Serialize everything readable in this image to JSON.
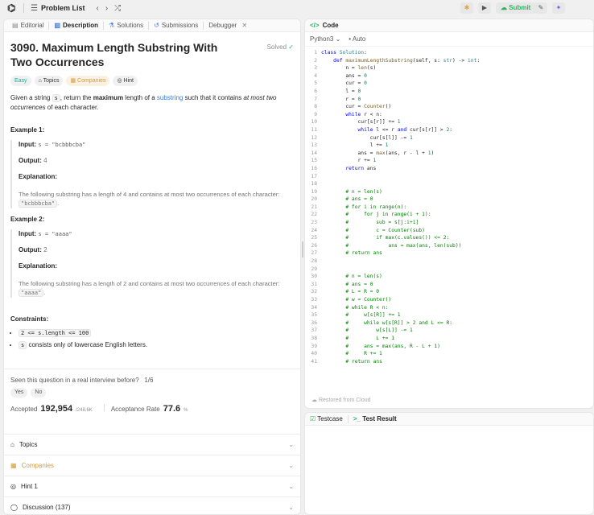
{
  "topbar": {
    "title": "Problem List",
    "submit_label": "Submit"
  },
  "left": {
    "tabs": [
      "Editorial",
      "Description",
      "Solutions",
      "Submissions",
      "Debugger"
    ],
    "title": "3090. Maximum Length Substring With Two Occurrences",
    "solved": "Solved",
    "chips": [
      "Easy",
      "Topics",
      "Companies",
      "Hint"
    ],
    "desc": {
      "p1": "Given a string ",
      "s": "s",
      "p2": ", return the ",
      "max": "maximum",
      "p3": " length of a ",
      "substring": "substring",
      "p4": " such that it contains ",
      "em": "at most two occurrences",
      "p5": " of each character."
    },
    "ex1": {
      "heading": "Example 1:",
      "input_label": "Input:",
      "input": "s = \"bcbbbcba\"",
      "output_label": "Output:",
      "output": "4",
      "expl_label": "Explanation:",
      "expl": "The following substring has a length of 4 and contains at most two occurrences of each character:",
      "sub": "\"bcbbbcba\"",
      "dot": "."
    },
    "ex2": {
      "heading": "Example 2:",
      "input_label": "Input:",
      "input": "s = \"aaaa\"",
      "output_label": "Output:",
      "output": "2",
      "expl_label": "Explanation:",
      "expl": "The following substring has a length of 2 and contains at most two occurrences of each character:",
      "sub": "\"aaaa\"",
      "dot": "."
    },
    "constraints": {
      "heading": "Constraints:",
      "c1": "2 <= s.length <= 100",
      "c2_code": "s",
      "c2_text": " consists only of lowercase English letters."
    },
    "seen": "Seen this question in a real interview before?",
    "seen_count": "1/6",
    "yes": "Yes",
    "no": "No",
    "accepted_label": "Accepted",
    "accepted": "192,954",
    "accepted_total": "/248.6K",
    "rate_label": "Acceptance Rate",
    "rate": "77.6",
    "rate_unit": "%",
    "accordion": [
      "Topics",
      "Companies",
      "Hint 1",
      "Discussion (137)"
    ]
  },
  "code": {
    "title": "Code",
    "lang": "Python3",
    "auto": "Auto",
    "restored": "Restored from Cloud",
    "lines": [
      "class Solution:",
      "    def maximumLengthSubstring(self, s: str) -> int:",
      "        n = len(s)",
      "        ans = 0",
      "        cur = 0",
      "        l = 0",
      "        r = 0",
      "        cur = Counter()",
      "        while r < n:",
      "            cur[s[r]] += 1",
      "            while l <= r and cur[s[r]] > 2:",
      "                cur[s[l]] -= 1",
      "                l += 1",
      "            ans = max(ans, r - l + 1)",
      "            r += 1",
      "        return ans",
      "",
      "",
      "        # n = len(s)",
      "        # ans = 0",
      "        # for i in range(n):",
      "        #     for j in range(i + 1):",
      "        #         sub = s[j:i+1]",
      "        #         c = Counter(sub)",
      "        #         if max(c.values()) <= 2:",
      "        #             ans = max(ans, len(sub))",
      "        # return ans",
      "",
      "",
      "        # n = len(s)",
      "        # ans = 0",
      "        # L = R = 0",
      "        # w = Counter()",
      "        # while R < n:",
      "        #     w[s[R]] += 1",
      "        #     while w[s[R]] > 2 and L <= R:",
      "        #         w[s[L]] -= 1",
      "        #         L += 1",
      "        #     ans = max(ans, R - L + 1)",
      "        #     R += 1",
      "        # return ans"
    ]
  },
  "test": {
    "testcase": "Testcase",
    "result": "Test Result"
  }
}
